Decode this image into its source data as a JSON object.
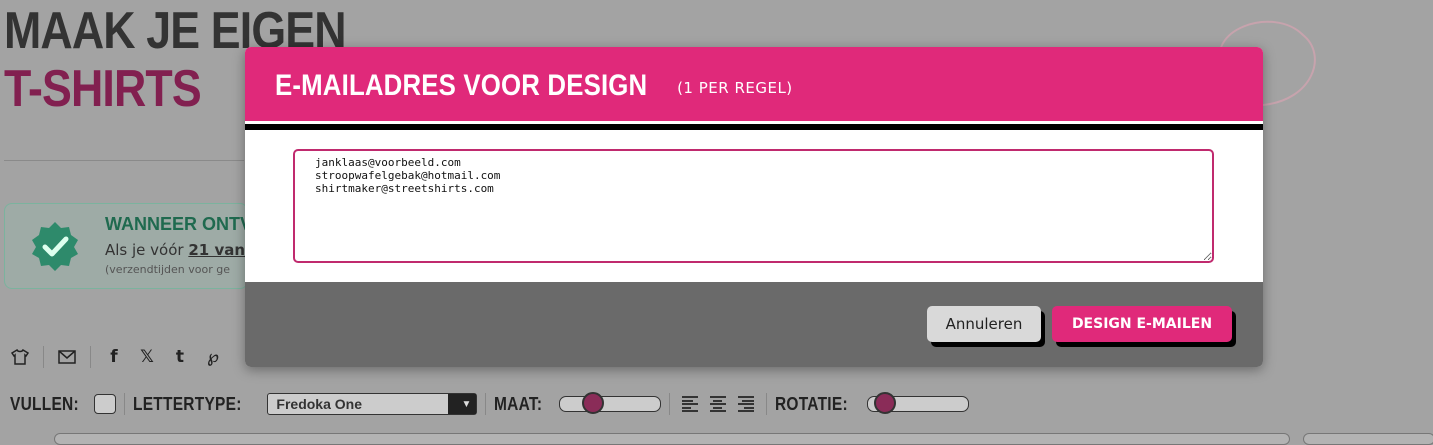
{
  "hero": {
    "line1": "MAAK JE EIGEN",
    "line2": "T-SHIRTS"
  },
  "info": {
    "heading": "WANNEER ONTVA",
    "text_prefix": "Als je vóór ",
    "text_strong": "21 van",
    "subtext": "(verzendtijden voor ge"
  },
  "toolbar": {
    "fill_label": "VULLEN:",
    "font_label": "LETTERTYPE:",
    "font_value": "Fredoka One",
    "size_label": "MAAT:",
    "size_level": 0.28,
    "rotation_label": "ROTATIE:",
    "rotation_level": 0.08
  },
  "modal": {
    "title": "E-MAILADRES VOOR DESIGN",
    "title_hint": "(1 PER REGEL)",
    "emails": "janklaas@voorbeeld.com\nstroopwafelgebak@hotmail.com\nshirtmaker@streetshirts.com",
    "cancel_label": "Annuleren",
    "send_label": "DESIGN E-MAILEN"
  },
  "colors": {
    "brand_pink": "#e0297a",
    "dark_pink": "#822050",
    "green": "#1f6a4f"
  }
}
